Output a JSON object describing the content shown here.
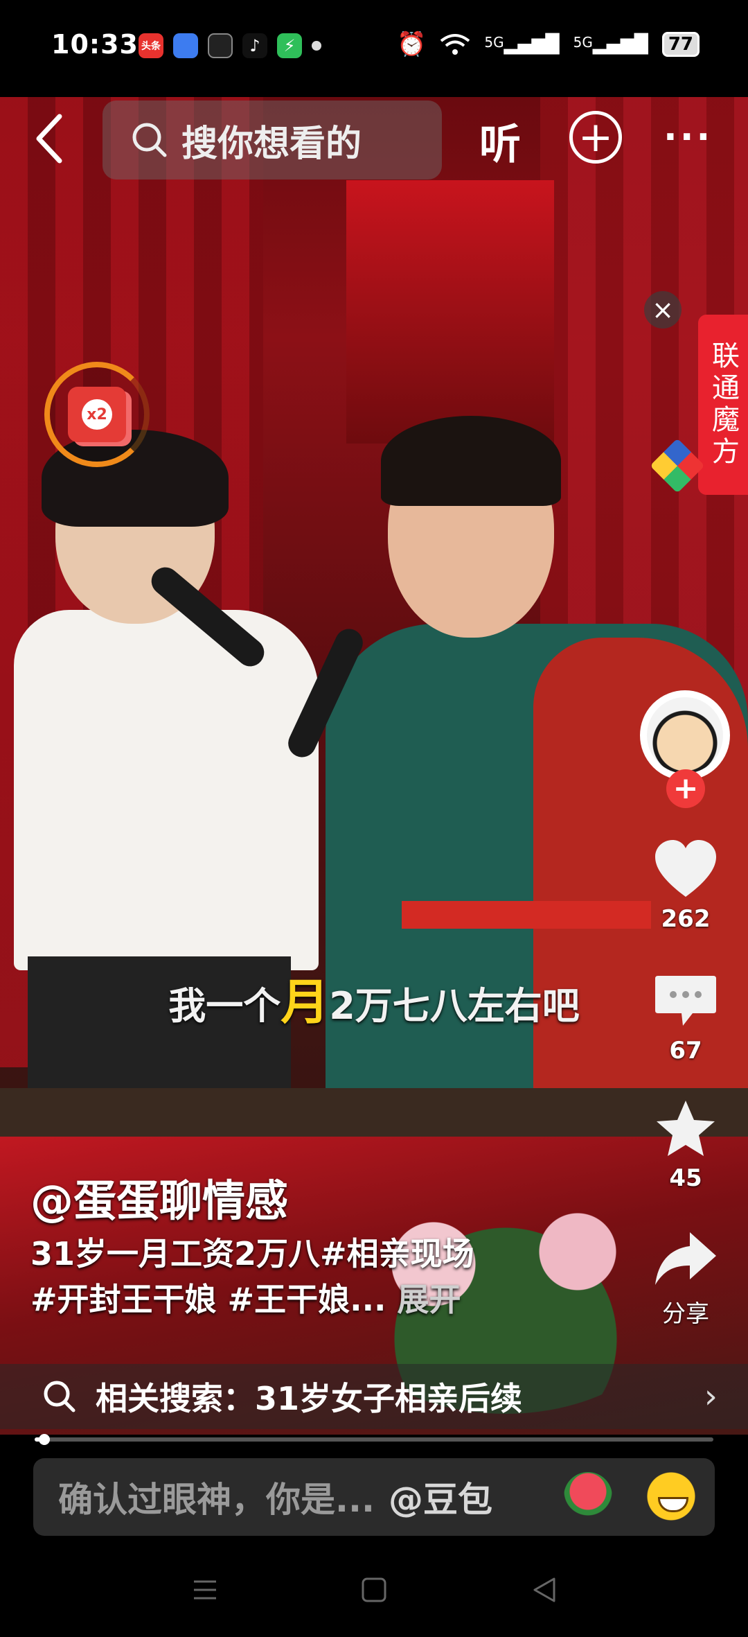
{
  "status_bar": {
    "time": "10:33",
    "app_icons": [
      {
        "name": "toutiao-icon",
        "label": "头条",
        "color": "#e8322e"
      },
      {
        "name": "app-blue-icon",
        "label": "",
        "color": "#3d7cf0"
      },
      {
        "name": "app-dark-icon",
        "label": "",
        "color": "#222222"
      },
      {
        "name": "tiktok-icon",
        "label": "",
        "color": "#111111"
      },
      {
        "name": "security-icon",
        "label": "",
        "color": "#2fbf5a"
      }
    ],
    "network_1": "5G",
    "network_2": "5G",
    "battery": "77"
  },
  "top_nav": {
    "search_placeholder": "搜你想看的",
    "listen_label": "听"
  },
  "red_packet": {
    "multiplier": "x2"
  },
  "ad": {
    "label": "联通魔方"
  },
  "subtitle": {
    "before": "我一个",
    "highlight": "月",
    "after": "2万七八左右吧"
  },
  "video_info": {
    "author": "@蛋蛋聊情感",
    "caption_line1": "31岁一月工资2万八#相亲现场",
    "caption_line2": "#开封王干娘 #王干娘...",
    "expand_label": "展开"
  },
  "actions": {
    "likes": "262",
    "comments": "67",
    "favorites": "45",
    "share_label": "分享"
  },
  "related_search": {
    "text": "相关搜索：31岁女子相亲后续"
  },
  "progress": {
    "fraction": 0.02
  },
  "comment_bar": {
    "placeholder": "确认过眼神，你是...",
    "mention": "@豆包"
  },
  "colors": {
    "accent_red": "#f03a3a",
    "subtitle_highlight": "#ffd31a",
    "ad_red": "#e8222e",
    "packet_ring": "#f08a1a"
  }
}
